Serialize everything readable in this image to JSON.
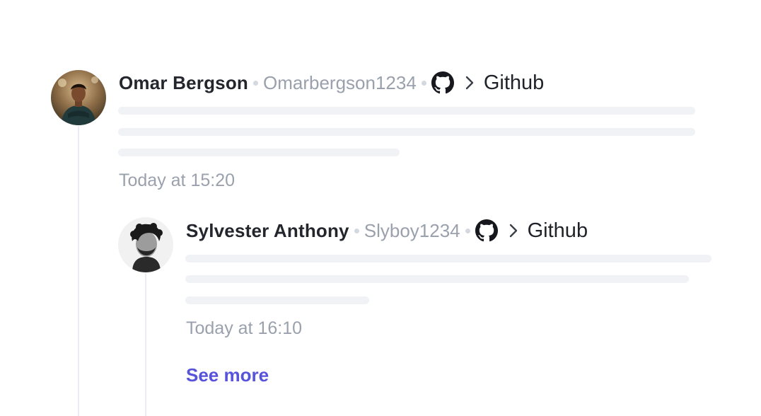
{
  "comments": [
    {
      "author": "Omar Bergson",
      "handle": "Omarbergson1234",
      "source_icon": "github-icon",
      "source_label": "Github",
      "time": "Today at 15:20"
    },
    {
      "author": "Sylvester Anthony",
      "handle": "Slyboy1234",
      "source_icon": "github-icon",
      "source_label": "Github",
      "time": "Today at 16:10"
    }
  ],
  "see_more_label": "See more",
  "colors": {
    "link": "#5753db",
    "muted": "#9aa1ad",
    "skeleton": "#f0f2f6",
    "text": "#23262d"
  }
}
